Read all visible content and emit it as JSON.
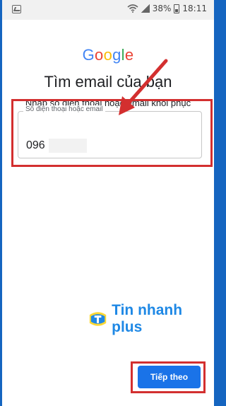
{
  "status_bar": {
    "battery_percent": "38%",
    "time": "18:11",
    "icons": [
      "image-icon",
      "wifi-icon",
      "signal-icon",
      "battery-icon"
    ]
  },
  "logo": {
    "letters": [
      "G",
      "o",
      "o",
      "g",
      "l",
      "e"
    ],
    "colors": [
      "#4285F4",
      "#EA4335",
      "#FBBC05",
      "#4285F4",
      "#34A853",
      "#EA4335"
    ]
  },
  "header": {
    "title": "Tìm email của bạn",
    "subtitle": "Nhập số điện thoại hoặc email khôi phục"
  },
  "form": {
    "label": "Số điện thoại hoặc email",
    "value": "096"
  },
  "actions": {
    "next_label": "Tiếp theo"
  },
  "watermark": {
    "text": "Tin nhanh plus"
  },
  "colors": {
    "annotation_red": "#d32f2f",
    "button_blue": "#1a73e8",
    "frame_blue": "#1565c0"
  }
}
